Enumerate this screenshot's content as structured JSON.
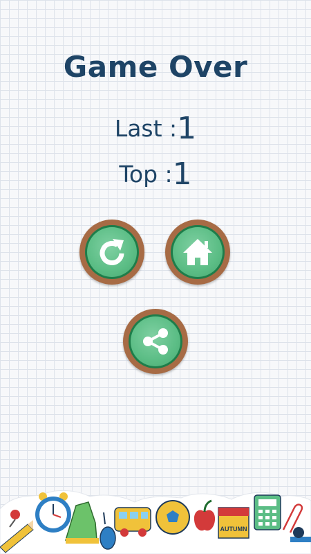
{
  "title": "Game Over",
  "scores": {
    "last_label": "Last :",
    "last_value": "1",
    "top_label": "Top :",
    "top_value": "1"
  },
  "buttons": {
    "replay_icon": "replay-icon",
    "home_icon": "home-icon",
    "share_icon": "share-icon"
  },
  "decoration": {
    "calendar_text": "AUTUMN"
  },
  "colors": {
    "title": "#1e4466",
    "button_rim": "#a76b45",
    "button_ring": "#1e7d4a",
    "button_face": "#5bbd85"
  }
}
